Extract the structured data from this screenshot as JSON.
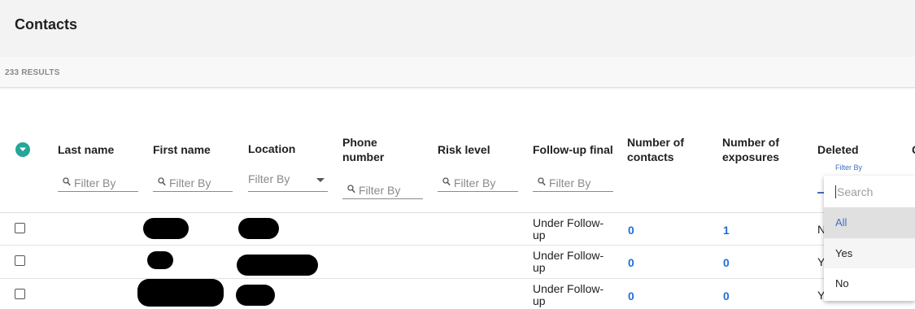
{
  "page": {
    "title": "Contacts",
    "results": "233 RESULTS"
  },
  "columns": [
    "Last name",
    "First name",
    "Location",
    "Phone number",
    "Risk level",
    "Follow-up final",
    "Number of contacts",
    "Number of exposures",
    "Deleted"
  ],
  "filter": {
    "placeholder": "Filter By",
    "deleted_label": "Filter By"
  },
  "rows": [
    {
      "followup": "Under Follow-up",
      "contacts": "0",
      "exposures": "1",
      "deleted": "N"
    },
    {
      "followup": "Under Follow-up",
      "contacts": "0",
      "exposures": "0",
      "deleted": "Y"
    },
    {
      "followup": "Under Follow-up",
      "contacts": "0",
      "exposures": "0",
      "deleted": "Y"
    }
  ],
  "dropdown": {
    "search_placeholder": "Search",
    "options": [
      "All",
      "Yes",
      "No"
    ],
    "selected": "All"
  },
  "colors": {
    "accent": "#26a69a",
    "link": "#1e6fd9",
    "filter_active": "#3f6fc4"
  },
  "icons": {
    "expand": "chevron-down-icon",
    "search": "magnifier-icon",
    "dropdown": "caret-down-icon"
  }
}
